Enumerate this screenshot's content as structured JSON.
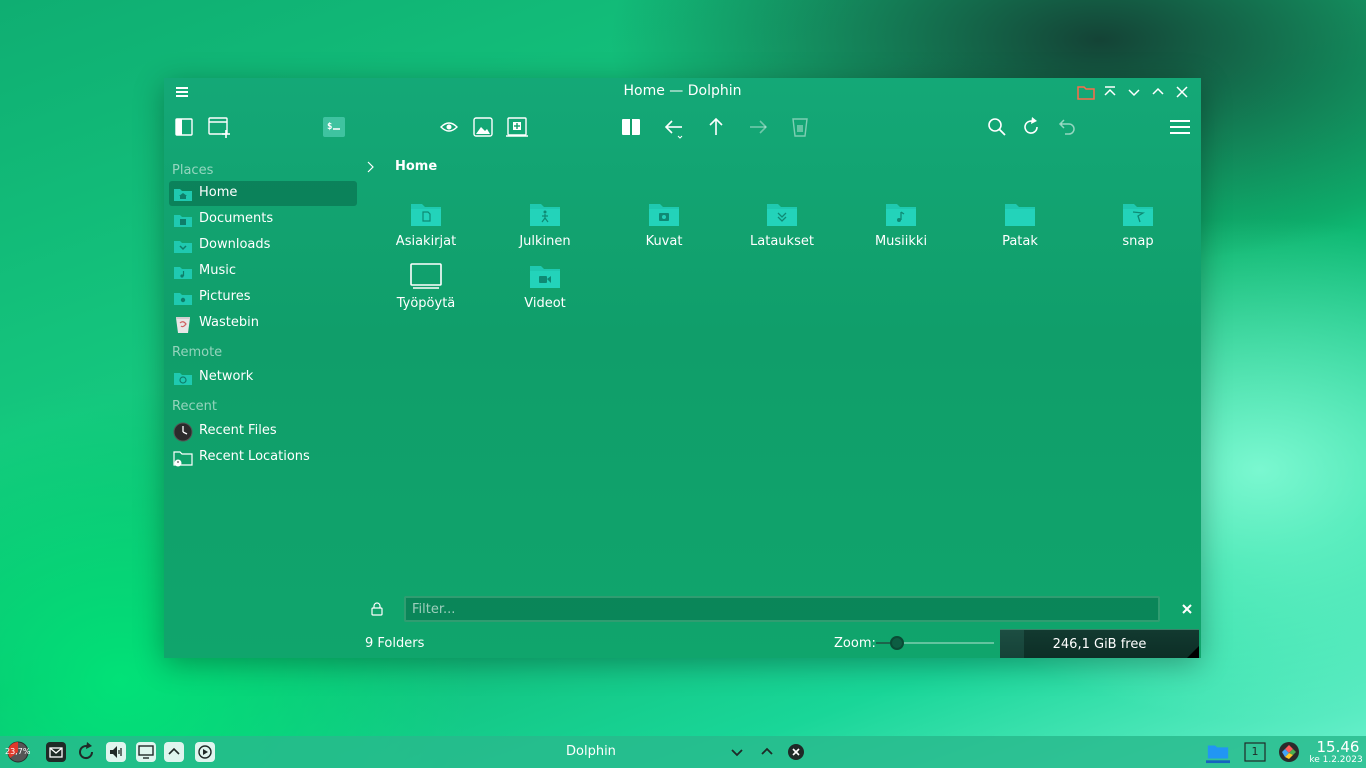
{
  "window": {
    "title": "Home — Dolphin"
  },
  "places": {
    "sections": {
      "places": "Places",
      "remote": "Remote",
      "recent": "Recent"
    },
    "items": [
      {
        "label": "Home",
        "icon": "home-folder-icon",
        "active": true
      },
      {
        "label": "Documents",
        "icon": "documents-folder-icon"
      },
      {
        "label": "Downloads",
        "icon": "downloads-folder-icon"
      },
      {
        "label": "Music",
        "icon": "music-folder-icon"
      },
      {
        "label": "Pictures",
        "icon": "pictures-folder-icon"
      },
      {
        "label": "Wastebin",
        "icon": "wastebin-icon"
      },
      {
        "label": "Network",
        "icon": "network-folder-icon"
      },
      {
        "label": "Recent Files",
        "icon": "recent-files-icon"
      },
      {
        "label": "Recent Locations",
        "icon": "recent-locations-icon"
      }
    ]
  },
  "breadcrumb": {
    "current": "Home"
  },
  "folders": [
    {
      "label": "Asiakirjat",
      "icon": "document-folder-icon"
    },
    {
      "label": "Julkinen",
      "icon": "public-folder-icon"
    },
    {
      "label": "Kuvat",
      "icon": "pictures-folder-icon"
    },
    {
      "label": "Lataukset",
      "icon": "downloads-folder-icon"
    },
    {
      "label": "Musiikki",
      "icon": "music-folder-icon"
    },
    {
      "label": "Patak",
      "icon": "folder-icon"
    },
    {
      "label": "snap",
      "icon": "snap-folder-icon"
    },
    {
      "label": "Työpöytä",
      "icon": "desktop-icon"
    },
    {
      "label": "Videot",
      "icon": "videos-folder-icon"
    }
  ],
  "filter": {
    "placeholder": "Filter..."
  },
  "status": {
    "items_text": "9 Folders",
    "zoom_label": "Zoom:",
    "zoom_level": 0.18,
    "free_space": "246,1 GiB free",
    "used_fraction": 0.12
  },
  "taskbar": {
    "cpu_text": "23,7%",
    "task_title": "Dolphin",
    "desktop_number": "1",
    "clock_time": "15.46",
    "clock_date": "ke 1.2.2023"
  },
  "colors": {
    "accent": "#1de9b6",
    "folder": "#1fc9b0",
    "window_bg": "#10a56c",
    "taskbar_bg": "#28b98c"
  }
}
